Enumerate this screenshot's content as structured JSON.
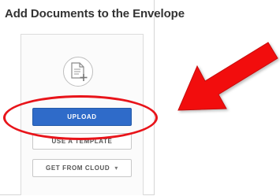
{
  "panel": {
    "title": "Add Documents to the Envelope"
  },
  "drop_zone": {
    "icon": "document-add-icon"
  },
  "buttons": {
    "upload_label": "UPLOAD",
    "template_label": "USE A TEMPLATE",
    "cloud_label": "GET FROM CLOUD",
    "cloud_chevron": "▾"
  },
  "annotation": {
    "highlight_color": "#e8141a",
    "arrow_color": "#f20d0d",
    "arrow_icon": "red-arrow"
  },
  "colors": {
    "primary_button": "#2f6bc9",
    "title_text": "#333333"
  }
}
